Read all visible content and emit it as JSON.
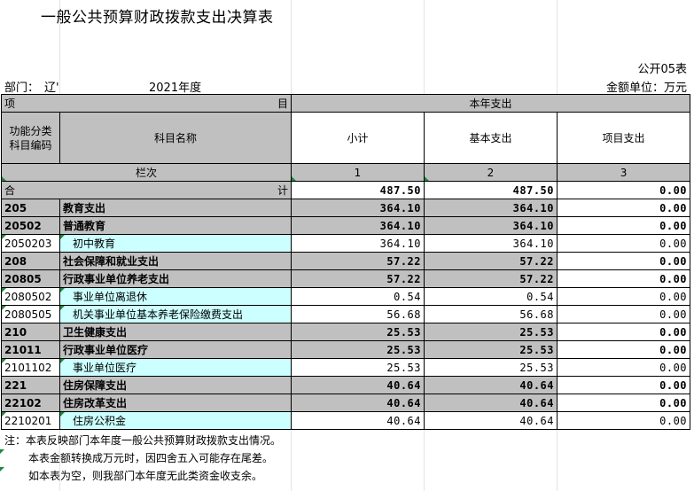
{
  "title": "一般公共预算财政拨款支出决算表",
  "form_no": "公开05表",
  "department_label": "部门：",
  "department_value": "辽'",
  "year": "2021年度",
  "unit": "金额单位：万元",
  "header": {
    "item_left": "项",
    "item_right": "目",
    "current_year": "本年支出",
    "func_code": "功能分类科目编码",
    "subject_name": "科目名称",
    "subtotal": "小计",
    "basic": "基本支出",
    "project": "项目支出",
    "col_index_label": "栏次",
    "col1": "1",
    "col2": "2",
    "col3": "3"
  },
  "total": {
    "left": "合",
    "right": "计",
    "subtotal": "487.50",
    "basic": "487.50",
    "project": "0.00"
  },
  "rows": [
    {
      "code": "205",
      "name": "教育支出",
      "subtotal": "364.10",
      "basic": "364.10",
      "project": "0.00",
      "level": 1
    },
    {
      "code": "20502",
      "name": "普通教育",
      "subtotal": "364.10",
      "basic": "364.10",
      "project": "0.00",
      "level": 2
    },
    {
      "code": "2050203",
      "name": "初中教育",
      "subtotal": "364.10",
      "basic": "364.10",
      "project": "0.00",
      "level": 3
    },
    {
      "code": "208",
      "name": "社会保障和就业支出",
      "subtotal": "57.22",
      "basic": "57.22",
      "project": "0.00",
      "level": 1
    },
    {
      "code": "20805",
      "name": "行政事业单位养老支出",
      "subtotal": "57.22",
      "basic": "57.22",
      "project": "0.00",
      "level": 2
    },
    {
      "code": "2080502",
      "name": "事业单位离退休",
      "subtotal": "0.54",
      "basic": "0.54",
      "project": "0.00",
      "level": 3
    },
    {
      "code": "2080505",
      "name": "机关事业单位基本养老保险缴费支出",
      "subtotal": "56.68",
      "basic": "56.68",
      "project": "0.00",
      "level": 3
    },
    {
      "code": "210",
      "name": "卫生健康支出",
      "subtotal": "25.53",
      "basic": "25.53",
      "project": "0.00",
      "level": 1
    },
    {
      "code": "21011",
      "name": "行政事业单位医疗",
      "subtotal": "25.53",
      "basic": "25.53",
      "project": "0.00",
      "level": 2
    },
    {
      "code": "2101102",
      "name": "事业单位医疗",
      "subtotal": "25.53",
      "basic": "25.53",
      "project": "0.00",
      "level": 3
    },
    {
      "code": "221",
      "name": "住房保障支出",
      "subtotal": "40.64",
      "basic": "40.64",
      "project": "0.00",
      "level": 1
    },
    {
      "code": "22102",
      "name": "住房改革支出",
      "subtotal": "40.64",
      "basic": "40.64",
      "project": "0.00",
      "level": 2
    },
    {
      "code": "2210201",
      "name": "住房公积金",
      "subtotal": "40.64",
      "basic": "40.64",
      "project": "0.00",
      "level": 3
    }
  ],
  "notes": [
    "注：本表反映部门本年度一般公共预算财政拨款支出情况。",
    "本表金额转换成万元时，因四舍五入可能存在尾差。",
    "如本表为空，则我部门本年度无此类资金收支余。"
  ]
}
